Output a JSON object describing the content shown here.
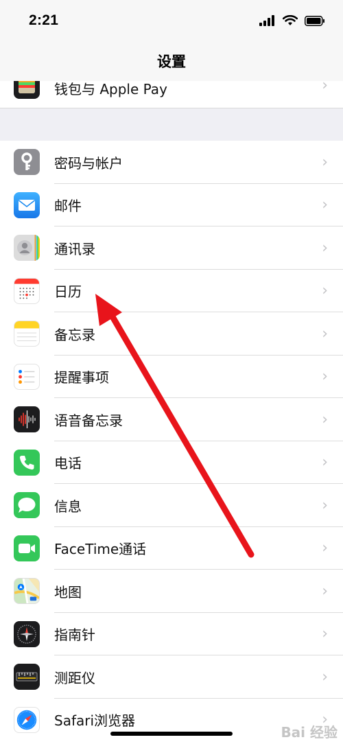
{
  "status_bar": {
    "time": "2:21"
  },
  "nav": {
    "title": "设置"
  },
  "top_item": {
    "label": "钱包与 Apple Pay",
    "icon": "wallet-icon"
  },
  "items": [
    {
      "label": "密码与帐户",
      "icon": "key-icon",
      "color": "#8e8e93"
    },
    {
      "label": "邮件",
      "icon": "mail-icon",
      "color": "#1e8cf0"
    },
    {
      "label": "通讯录",
      "icon": "contacts-icon",
      "color": "#d9d9d9"
    },
    {
      "label": "日历",
      "icon": "calendar-icon",
      "color": "#ffffff"
    },
    {
      "label": "备忘录",
      "icon": "notes-icon",
      "color": "#ffd426"
    },
    {
      "label": "提醒事项",
      "icon": "reminders-icon",
      "color": "#ffffff"
    },
    {
      "label": "语音备忘录",
      "icon": "voice-memos-icon",
      "color": "#1c1c1e"
    },
    {
      "label": "电话",
      "icon": "phone-icon",
      "color": "#34c759"
    },
    {
      "label": "信息",
      "icon": "messages-icon",
      "color": "#34c759"
    },
    {
      "label": "FaceTime通话",
      "icon": "facetime-icon",
      "color": "#34c759"
    },
    {
      "label": "地图",
      "icon": "maps-icon",
      "color": "#e8f1e4"
    },
    {
      "label": "指南针",
      "icon": "compass-icon",
      "color": "#1c1c1e"
    },
    {
      "label": "测距仪",
      "icon": "measure-icon",
      "color": "#1c1c1e"
    },
    {
      "label": "Safari浏览器",
      "icon": "safari-icon",
      "color": "#ffffff"
    }
  ],
  "annotation": {
    "color": "#e8141b",
    "icon": "arrow-pointing-to-calendar"
  },
  "watermark": "Bai 经验"
}
